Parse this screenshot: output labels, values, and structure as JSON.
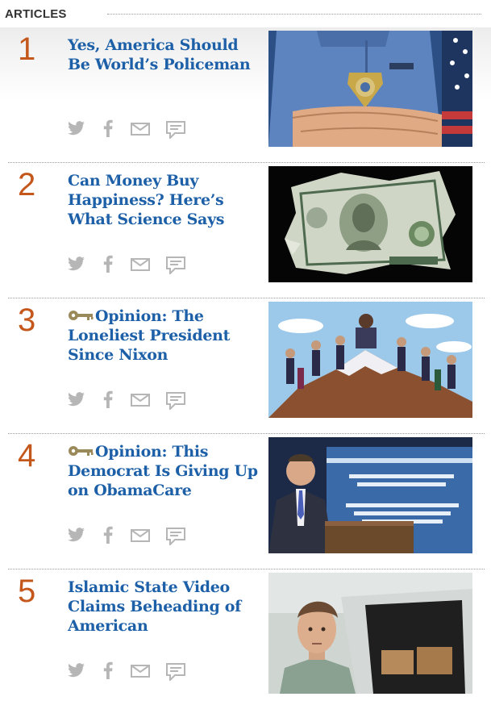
{
  "section": {
    "label": "ARTICLES"
  },
  "articles": [
    {
      "rank": "1",
      "title": "Yes, America Should Be World’s Policeman",
      "premium": false,
      "image_name": "police-officer-image"
    },
    {
      "rank": "2",
      "title": "Can Money Buy Happiness? Here’s What Science Says",
      "premium": false,
      "image_name": "dollar-bill-image"
    },
    {
      "rank": "3",
      "title": "Opinion: The Loneliest President Since Nixon",
      "premium": true,
      "image_name": "political-cartoon-image"
    },
    {
      "rank": "4",
      "title": "Opinion: This Democrat Is Giving Up on ObamaCare",
      "premium": true,
      "image_name": "press-briefing-image"
    },
    {
      "rank": "5",
      "title": "Islamic State Video Claims Beheading of American",
      "premium": false,
      "image_name": "reporter-van-image"
    }
  ],
  "share_icons": [
    "twitter-icon",
    "facebook-icon",
    "email-icon",
    "comment-icon"
  ],
  "colors": {
    "rank": "#c4581c",
    "title": "#1d60a8",
    "icon": "#b6b6b6",
    "key": "#9a8a5a"
  }
}
